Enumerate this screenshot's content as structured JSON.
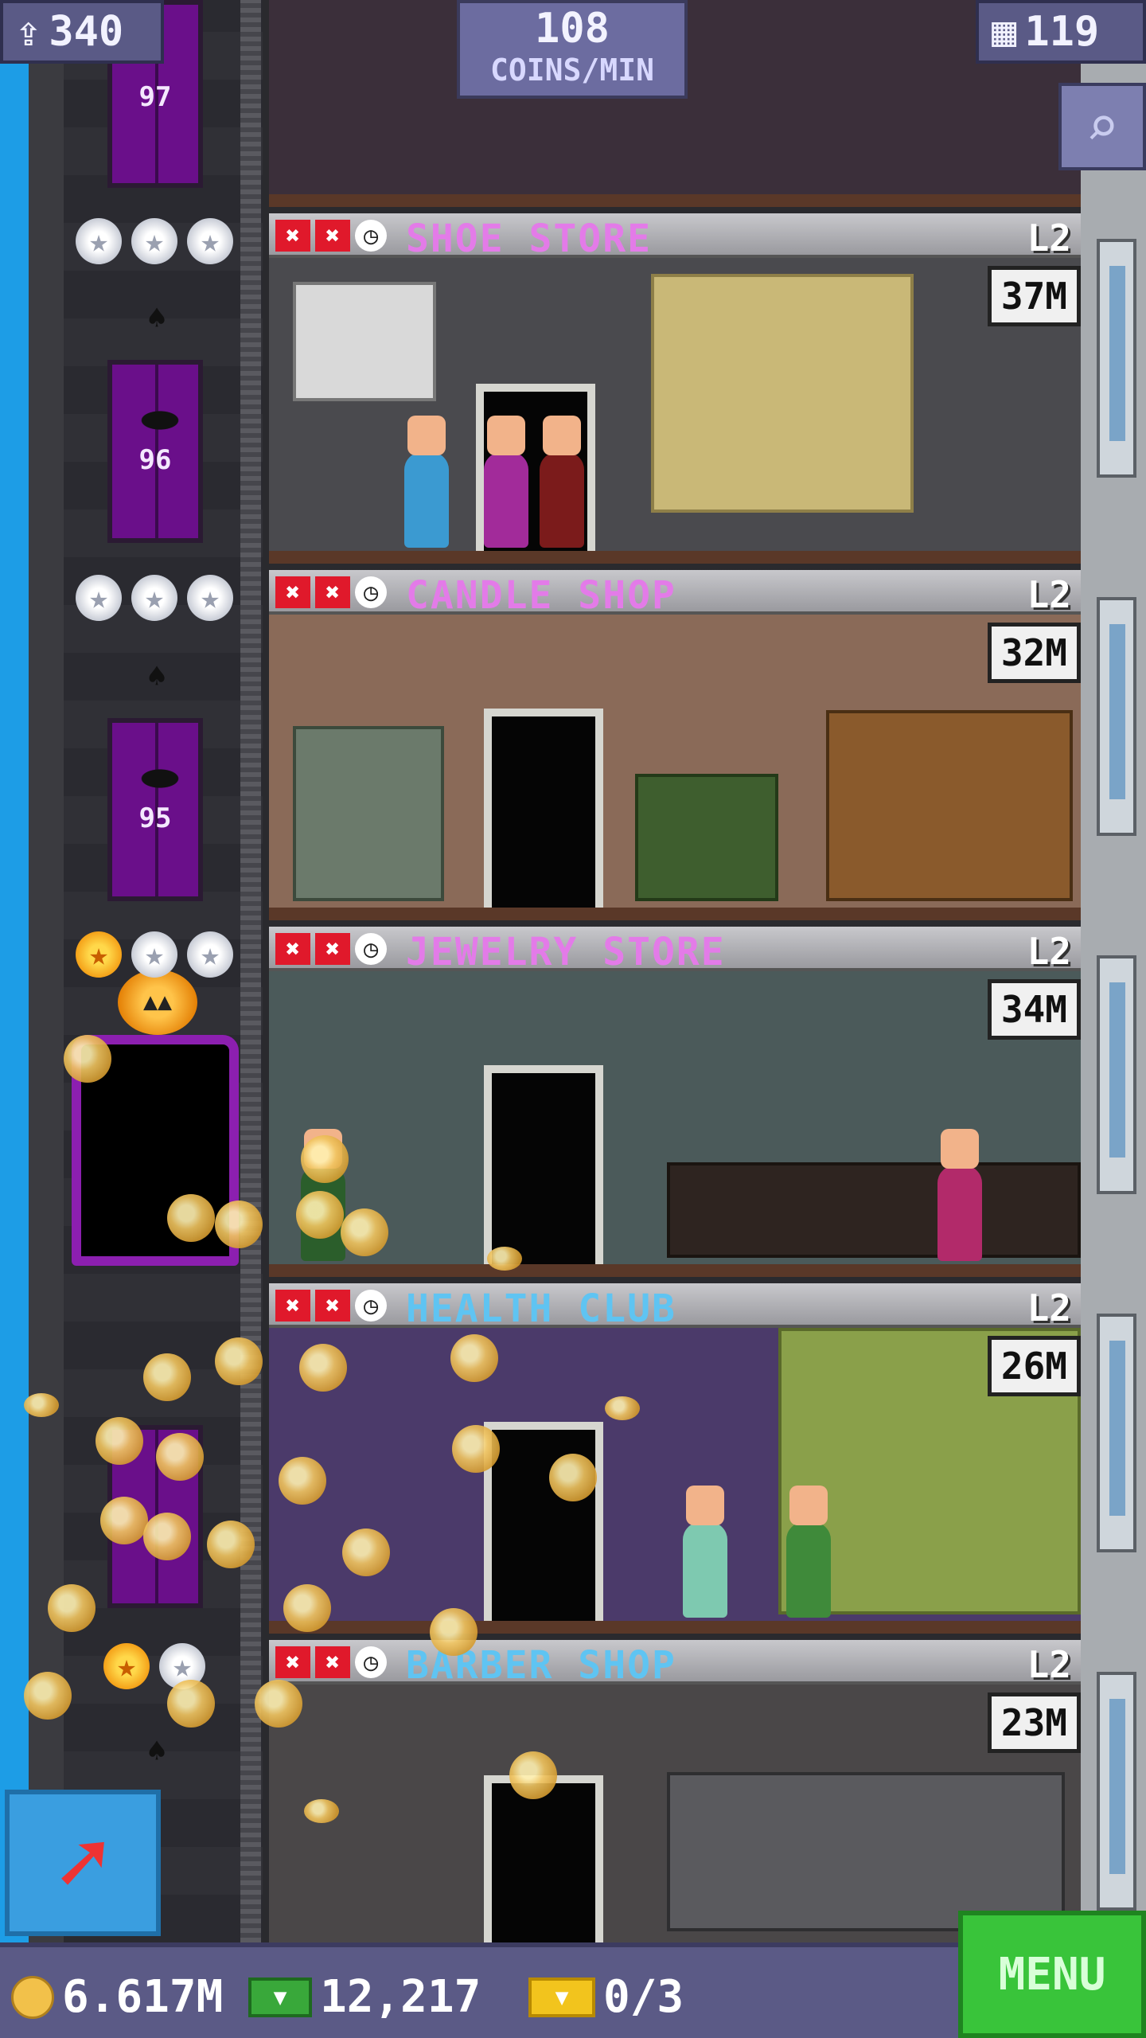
{
  "top_bar": {
    "population": "340",
    "coins_per_min_value": "108",
    "coins_per_min_label": "COINS/MIN",
    "floors": "119",
    "magnify_icon": "magnifier-icon"
  },
  "elevator": {
    "floor_numbers": [
      "97",
      "96",
      "95"
    ]
  },
  "floors": [
    {
      "name": "SHOE STORE",
      "level": "L2",
      "timer": "37M",
      "name_color": "#e37be8",
      "stars": [
        "silver",
        "silver",
        "silver"
      ]
    },
    {
      "name": "CANDLE SHOP",
      "level": "L2",
      "timer": "32M",
      "name_color": "#e37be8",
      "stars": [
        "silver",
        "silver",
        "silver"
      ]
    },
    {
      "name": "JEWELRY STORE",
      "level": "L2",
      "timer": "34M",
      "name_color": "#e37be8",
      "stars": [
        "gold",
        "silver",
        "silver"
      ]
    },
    {
      "name": "HEALTH CLUB",
      "level": "L2",
      "timer": "26M",
      "name_color": "#5fc4f2",
      "stars": []
    },
    {
      "name": "BARBER SHOP",
      "level": "L2",
      "timer": "23M",
      "name_color": "#5fc4f2",
      "stars": [
        "gold",
        "silver"
      ]
    }
  ],
  "bottom_bar": {
    "coins": "6.617M",
    "bux": "12,217",
    "tickets": "0/3",
    "menu_label": "MENU"
  },
  "colors": {
    "sky": "#1d9de6",
    "menu_green": "#39c43a",
    "elevator_purple": "#6a0f8a",
    "bar_purple": "#5b5a86"
  }
}
